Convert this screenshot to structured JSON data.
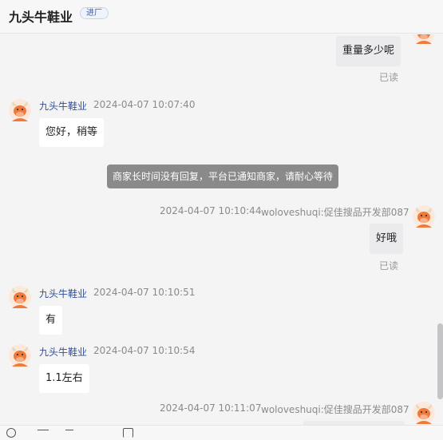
{
  "header": {
    "shop_name": "九头牛鞋业",
    "badge": "进厂"
  },
  "messages": [
    {
      "side": "right",
      "text": "重量多少呢",
      "status": "已读"
    },
    {
      "side": "left",
      "sender": "九头牛鞋业",
      "time": "2024-04-07 10:07:40",
      "text": "您好，稍等"
    },
    {
      "side": "system",
      "text": "商家长时间没有回复，平台已通知商家，请耐心等待"
    },
    {
      "side": "right",
      "sender": "woloveshuqi:促佳搜品开发部087",
      "time": "2024-04-07 10:10:44",
      "text": "好哦",
      "status": "已读"
    },
    {
      "side": "left",
      "sender": "九头牛鞋业",
      "time": "2024-04-07 10:10:51",
      "text": "有"
    },
    {
      "side": "left",
      "sender": "九头牛鞋业",
      "time": "2024-04-07 10:10:54",
      "text": "1.1左右"
    },
    {
      "side": "right",
      "sender": "woloveshuqi:促佳搜品开发部087",
      "time": "2024-04-07 10:11:07"
    }
  ],
  "icons": {
    "avatar": "bull-avatar-icon"
  },
  "colors": {
    "name_link": "#2f4f9c",
    "avatar_orange": "#f07a3a",
    "system_bg": "#8a8a8a",
    "page_bg": "#f4f4f5"
  }
}
